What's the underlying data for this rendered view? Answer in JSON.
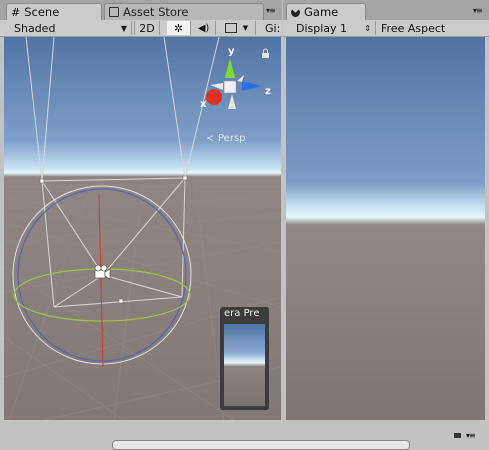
{
  "scene_panel": {
    "tabs": [
      {
        "label": "Scene",
        "icon": "grid-icon",
        "active": true
      },
      {
        "label": "Asset Store",
        "icon": "shopping-bag-icon",
        "active": false
      }
    ],
    "toolbar": {
      "shading_mode": "Shaded",
      "mode_2d": "2D",
      "gizmos_label": "Gi:"
    },
    "gizmo": {
      "y_label": "y",
      "z_label": "z",
      "x_label": "x",
      "projection_label": "Persp"
    },
    "camera_preview": {
      "title": "era Pre"
    }
  },
  "game_panel": {
    "tabs": [
      {
        "label": "Game",
        "icon": "pacman-icon",
        "active": true
      }
    ],
    "toolbar": {
      "display": "Display 1",
      "aspect": "Free Aspect"
    }
  },
  "colors": {
    "sky_top": "#4f74a5",
    "horizon": "#e7f7fb",
    "ground": "#7f7573",
    "axis_y": "#7cdc2a",
    "axis_x": "#e0301e",
    "axis_z": "#2e6fe0",
    "panel_bg": "#cbcbcb"
  }
}
